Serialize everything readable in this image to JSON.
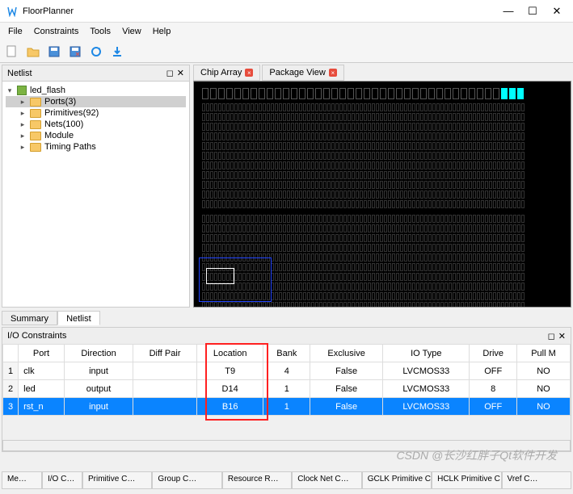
{
  "window": {
    "title": "FloorPlanner"
  },
  "menu": [
    "File",
    "Constraints",
    "Tools",
    "View",
    "Help"
  ],
  "netlist": {
    "title": "Netlist",
    "root": "led_flash",
    "items": [
      {
        "label": "Ports(3)",
        "selected": true
      },
      {
        "label": "Primitives(92)"
      },
      {
        "label": "Nets(100)"
      },
      {
        "label": "Module"
      },
      {
        "label": "Timing Paths"
      }
    ]
  },
  "chip_tabs": [
    {
      "label": "Chip Array"
    },
    {
      "label": "Package View"
    }
  ],
  "summary_tabs": {
    "summary": "Summary",
    "netlist": "Netlist"
  },
  "io": {
    "title": "I/O Constraints",
    "headers": [
      "Port",
      "Direction",
      "Diff Pair",
      "Location",
      "Bank",
      "Exclusive",
      "IO Type",
      "Drive",
      "Pull M"
    ],
    "rows": [
      {
        "n": "1",
        "port": "clk",
        "dir": "input",
        "diff": "",
        "loc": "T9",
        "bank": "4",
        "excl": "False",
        "iotype": "LVCMOS33",
        "drive": "OFF",
        "pull": "NO"
      },
      {
        "n": "2",
        "port": "led",
        "dir": "output",
        "diff": "",
        "loc": "D14",
        "bank": "1",
        "excl": "False",
        "iotype": "LVCMOS33",
        "drive": "8",
        "pull": "NO"
      },
      {
        "n": "3",
        "port": "rst_n",
        "dir": "input",
        "diff": "",
        "loc": "B16",
        "bank": "1",
        "excl": "False",
        "iotype": "LVCMOS33",
        "drive": "OFF",
        "pull": "NO",
        "selected": true
      }
    ]
  },
  "footer_tabs": [
    "Me…",
    "I/O C…",
    "Primitive C…",
    "Group C…",
    "Resource R…",
    "Clock Net C…",
    "GCLK Primitive C…",
    "HCLK Primitive C…",
    "Vref C…"
  ],
  "watermark": "CSDN @长沙红胖子Qt软件开发"
}
